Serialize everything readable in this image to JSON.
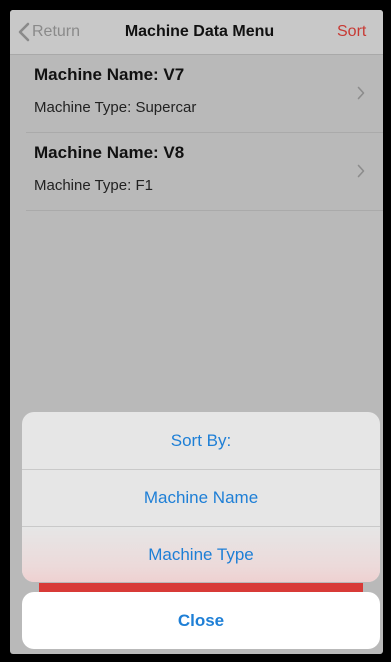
{
  "navbar": {
    "back_label": "Return",
    "title": "Machine Data Menu",
    "sort_label": "Sort"
  },
  "list": {
    "items": [
      {
        "name": "Machine Name: V7",
        "type": "Machine Type: Supercar"
      },
      {
        "name": "Machine Name: V8",
        "type": "Machine Type: F1"
      }
    ]
  },
  "action_sheet": {
    "title": "Sort By:",
    "options": [
      "Machine Name",
      "Machine Type"
    ],
    "cancel_label": "Close"
  },
  "colors": {
    "accent_blue": "#1e7fd6",
    "sort_red": "#c73a34",
    "banner_red": "#d83a37"
  },
  "icons": {
    "back": "chevron-left-icon",
    "row_disclosure": "chevron-right-icon"
  }
}
